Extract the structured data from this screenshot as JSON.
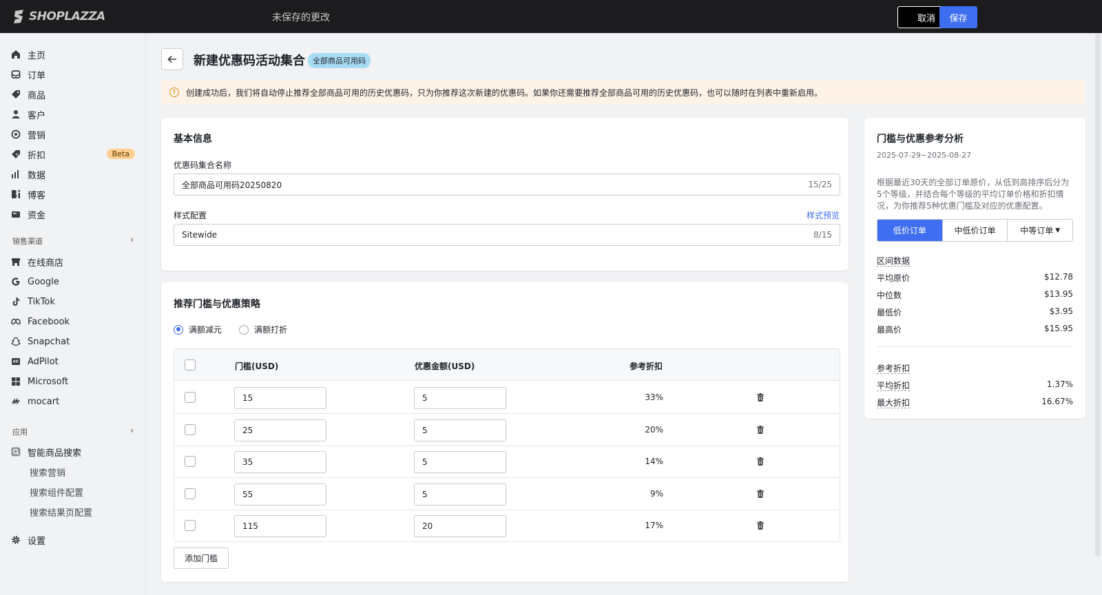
{
  "topbar": {
    "logo_text": "SHOPLAZZA",
    "unsaved_text": "未保存的更改",
    "cancel_label": "取消",
    "save_label": "保存"
  },
  "sidebar": {
    "items": [
      {
        "label": "主页",
        "icon": "home-icon"
      },
      {
        "label": "订单",
        "icon": "inbox-icon"
      },
      {
        "label": "商品",
        "icon": "tag-icon"
      },
      {
        "label": "客户",
        "icon": "person-icon"
      },
      {
        "label": "营销",
        "icon": "target-icon"
      },
      {
        "label": "折扣",
        "icon": "discount-icon",
        "badge": "Beta"
      },
      {
        "label": "数据",
        "icon": "bar-chart-icon"
      },
      {
        "label": "博客",
        "icon": "blog-icon"
      },
      {
        "label": "资金",
        "icon": "wallet-icon"
      }
    ],
    "sales_channel_label": "销售渠道",
    "channels": [
      {
        "label": "在线商店",
        "icon": "store-icon"
      },
      {
        "label": "Google",
        "icon": "google-icon"
      },
      {
        "label": "TikTok",
        "icon": "tiktok-icon"
      },
      {
        "label": "Facebook",
        "icon": "meta-icon"
      },
      {
        "label": "Snapchat",
        "icon": "snapchat-icon"
      },
      {
        "label": "AdPilot",
        "icon": "adpilot-icon"
      },
      {
        "label": "Microsoft",
        "icon": "microsoft-icon"
      },
      {
        "label": "mocart",
        "icon": "mocart-icon"
      }
    ],
    "apps_label": "应用",
    "app": {
      "label": "智能商品搜索",
      "icon": "smart-search-icon"
    },
    "app_subitems": [
      "搜索营销",
      "搜索组件配置",
      "搜索结果页配置"
    ],
    "settings_label": "设置"
  },
  "header": {
    "title": "新建优惠码活动集合",
    "tag": "全部商品可用码"
  },
  "alert": {
    "text": "创建成功后，我们将自动停止推荐全部商品可用的历史优惠码，只为你推荐这次新建的优惠码。如果你还需要推荐全部商品可用的历史优惠码，也可以随时在列表中重新启用。"
  },
  "basic": {
    "title": "基本信息",
    "name_label": "优惠码集合名称",
    "name_value": "全部商品可用码20250820",
    "name_count": "15/25",
    "style_label": "样式配置",
    "style_preview_link": "样式预览",
    "style_value": "Sitewide",
    "style_count": "8/15"
  },
  "strategy": {
    "title": "推荐门槛与优惠策略",
    "radio_amount": "满额减元",
    "radio_percent": "满额打折",
    "columns": [
      "门槛(USD)",
      "优惠金额(USD)",
      "参考折扣"
    ],
    "rows": [
      {
        "threshold": "15",
        "amount": "5",
        "discount": "33%"
      },
      {
        "threshold": "25",
        "amount": "5",
        "discount": "20%"
      },
      {
        "threshold": "35",
        "amount": "5",
        "discount": "14%"
      },
      {
        "threshold": "55",
        "amount": "5",
        "discount": "9%"
      },
      {
        "threshold": "115",
        "amount": "20",
        "discount": "17%"
      }
    ],
    "add_label": "添加门槛"
  },
  "analysis": {
    "title": "门槛与优惠参考分析",
    "date_range": "2025-07-29~2025-08-27",
    "description": "根据最近30天的全部订单原价，从低到高排序后分为5个等级，并结合每个等级的平均订单价格和折扣情况，为你推荐5种优惠门槛及对应的优惠配置。",
    "segments": [
      "低价订单",
      "中低价订单",
      "中等订单"
    ],
    "range_title": "区间数据",
    "range": [
      {
        "k": "平均原价",
        "v": "$12.78"
      },
      {
        "k": "中位数",
        "v": "$13.95"
      },
      {
        "k": "最低价",
        "v": "$3.95"
      },
      {
        "k": "最高价",
        "v": "$15.95"
      }
    ],
    "discount_title": "参考折扣",
    "discount": [
      {
        "k": "平均折扣",
        "v": "1.37%"
      },
      {
        "k": "最大折扣",
        "v": "16.67%"
      }
    ]
  },
  "colors": {
    "accent": "#3f6ef0",
    "topbar": "#1c1c1e",
    "alert_bg": "#fff3e7",
    "tag_bg": "#a8dcf4",
    "beta_bg": "#ffcf8f"
  }
}
